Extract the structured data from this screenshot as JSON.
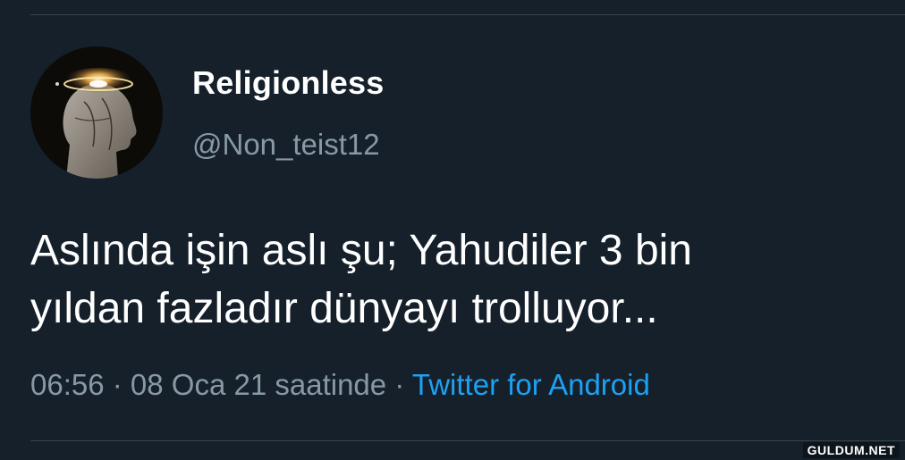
{
  "tweet": {
    "display_name": "Religionless",
    "handle": "@Non_teist12",
    "avatar_icon": "avatar-head-with-halo",
    "text_line_1": "Aslında işin aslı şu; Yahudiler 3 bin",
    "text_line_2": "yıldan fazladır dünyayı trolluyor...",
    "time": "06:56",
    "separator_1": " · ",
    "date": "08 Oca 21 saatinde",
    "separator_2": " · ",
    "source": "Twitter for Android"
  },
  "watermark": {
    "text": "GULDUM.NET"
  },
  "colors": {
    "background": "#15202b",
    "text_primary": "#ffffff",
    "text_secondary": "#8899a6",
    "link": "#1da1f2",
    "divider": "#38444d"
  }
}
